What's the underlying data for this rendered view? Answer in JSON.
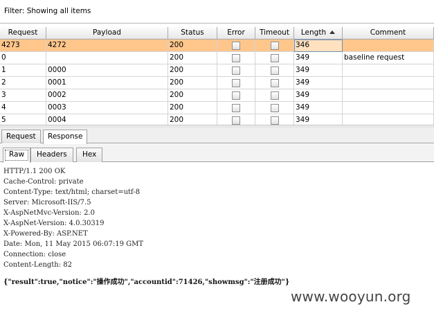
{
  "filter": {
    "label": "Filter: Showing all items"
  },
  "table": {
    "columns": [
      "Request",
      "Payload",
      "Status",
      "Error",
      "Timeout",
      "Length",
      "Comment"
    ],
    "rows": [
      {
        "request": "4273",
        "payload": "4272",
        "status": "200",
        "length": "346",
        "comment": "",
        "selected": true
      },
      {
        "request": "0",
        "payload": "",
        "status": "200",
        "length": "349",
        "comment": "baseline request",
        "selected": false
      },
      {
        "request": "1",
        "payload": "0000",
        "status": "200",
        "length": "349",
        "comment": "",
        "selected": false
      },
      {
        "request": "2",
        "payload": "0001",
        "status": "200",
        "length": "349",
        "comment": "",
        "selected": false
      },
      {
        "request": "3",
        "payload": "0002",
        "status": "200",
        "length": "349",
        "comment": "",
        "selected": false
      },
      {
        "request": "4",
        "payload": "0003",
        "status": "200",
        "length": "349",
        "comment": "",
        "selected": false
      },
      {
        "request": "5",
        "payload": "0004",
        "status": "200",
        "length": "349",
        "comment": "",
        "selected": false
      }
    ]
  },
  "tabs": {
    "request": "Request",
    "response": "Response",
    "active": "response"
  },
  "subtabs": {
    "raw": "Raw",
    "headers": "Headers",
    "hex": "Hex",
    "active": "raw"
  },
  "response": {
    "headers": [
      "HTTP/1.1 200 OK",
      "Cache-Control: private",
      "Content-Type: text/html; charset=utf-8",
      "Server: Microsoft-IIS/7.5",
      "X-AspNetMvc-Version: 2.0",
      "X-AspNet-Version: 4.0.30319",
      "X-Powered-By: ASP.NET",
      "Date: Mon, 11 May 2015 06:07:19 GMT",
      "Connection: close",
      "Content-Length: 82"
    ],
    "body": "{\"result\":true,\"notice\":\"操作成功\",\"accountid\":71426,\"showmsg\":\"注册成功\"}"
  },
  "watermark": "www.wooyun.org"
}
